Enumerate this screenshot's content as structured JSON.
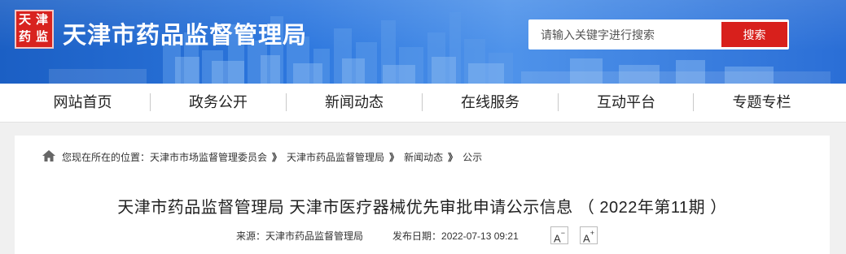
{
  "header": {
    "logo_text": "天津市药品监督管理局",
    "site_title": "天津市药品监督管理局",
    "search": {
      "placeholder": "请输入关键字进行搜索",
      "button_label": "搜索"
    },
    "colors": {
      "banner": "#2d77de",
      "search_button": "#d8201c",
      "logo": "#d8231f"
    }
  },
  "nav": {
    "items": [
      {
        "label": "网站首页"
      },
      {
        "label": "政务公开"
      },
      {
        "label": "新闻动态"
      },
      {
        "label": "在线服务"
      },
      {
        "label": "互动平台"
      },
      {
        "label": "专题专栏"
      }
    ]
  },
  "breadcrumb": {
    "prefix": "您现在所在的位置：",
    "items": [
      "天津市市场监督管理委员会",
      "天津市药品监督管理局",
      "新闻动态",
      "公示"
    ],
    "separator": "》",
    "icon": "home-icon"
  },
  "article": {
    "title": "天津市药品监督管理局 天津市医疗器械优先审批申请公示信息 （ 2022年第11期 ）",
    "source_label": "来源：天津市药品监督管理局",
    "date_label": "发布日期：2022-07-13 09:21",
    "font_decrease": "A",
    "font_decrease_sup": "−",
    "font_increase": "A",
    "font_increase_sup": "+"
  }
}
